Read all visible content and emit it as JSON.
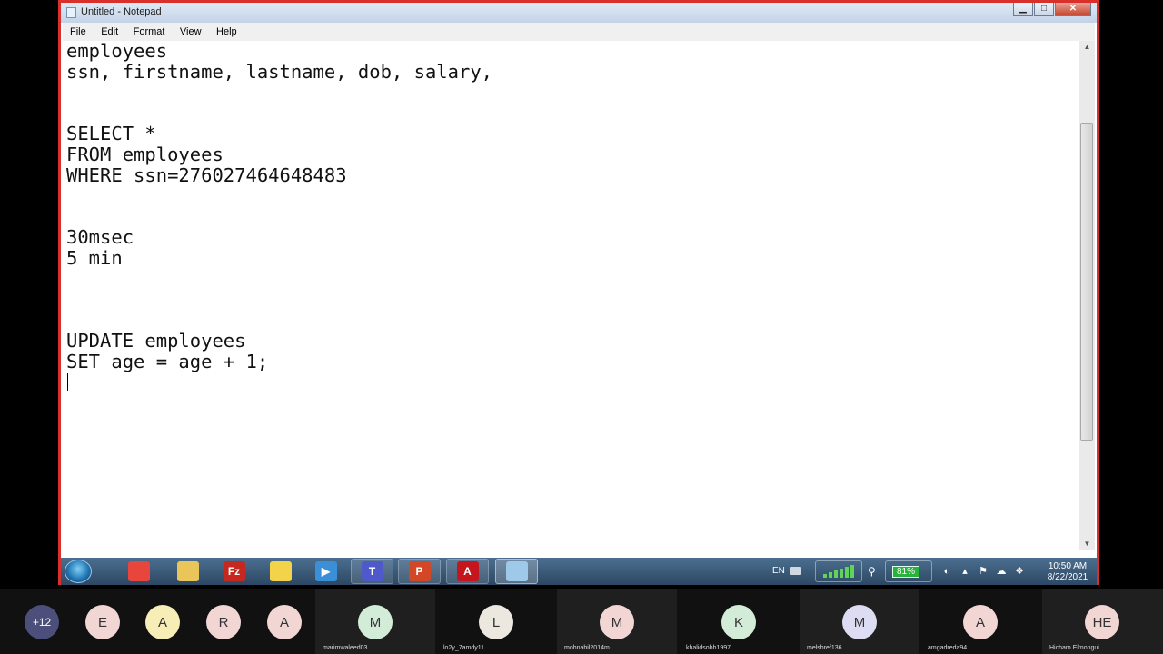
{
  "window": {
    "title": "Untitled - Notepad",
    "menu": [
      "File",
      "Edit",
      "Format",
      "View",
      "Help"
    ],
    "buttons": {
      "minimize": "▁",
      "maximize": "□",
      "close": "✕"
    }
  },
  "editor": {
    "lines": [
      "employees",
      "ssn, firstname, lastname, dob, salary,",
      "",
      "",
      "SELECT *",
      "FROM employees",
      "WHERE ssn=276027464648483",
      "",
      "",
      "30msec",
      "5 min",
      "",
      "",
      "",
      "UPDATE employees",
      "SET age = age + 1;"
    ]
  },
  "taskbar": {
    "apps": [
      {
        "name": "chrome-icon",
        "label": "",
        "color": "#e8453c"
      },
      {
        "name": "file-explorer-icon",
        "label": "",
        "color": "#e9c55a"
      },
      {
        "name": "filezilla-icon",
        "label": "Fz",
        "color": "#c6281f"
      },
      {
        "name": "folder-icon",
        "label": "",
        "color": "#f3d34a"
      },
      {
        "name": "media-player-icon",
        "label": "▶",
        "color": "#3a8fd6"
      },
      {
        "name": "teams-icon",
        "label": "T",
        "color": "#5059c9"
      },
      {
        "name": "powerpoint-icon",
        "label": "P",
        "color": "#d24726"
      },
      {
        "name": "acrobat-icon",
        "label": "A",
        "color": "#c4161c"
      },
      {
        "name": "notepad-icon",
        "label": "",
        "color": "#9ec9e8"
      }
    ],
    "tray": {
      "language": "EN",
      "battery": "81%",
      "time": "10:50 AM",
      "date": "8/22/2021"
    }
  },
  "participants": {
    "more_count": "+12",
    "small": [
      {
        "initial": "E",
        "color": "#f1d6d3"
      },
      {
        "initial": "A",
        "color": "#f7edb6"
      },
      {
        "initial": "R",
        "color": "#f1d6d3"
      },
      {
        "initial": "A",
        "color": "#f1d6d3"
      }
    ],
    "tiles": [
      {
        "initial": "M",
        "name": "marimwaleed03",
        "color": "#d3ecd8"
      },
      {
        "initial": "L",
        "name": "lo2y_7amdy11",
        "color": "#ece7df"
      },
      {
        "initial": "M",
        "name": "mohnabil2014m",
        "color": "#f1d6d3"
      },
      {
        "initial": "K",
        "name": "khalidsobh1997",
        "color": "#d3ecd8"
      },
      {
        "initial": "M",
        "name": "melshref136",
        "color": "#dcdcf3"
      },
      {
        "initial": "A",
        "name": "amgadreda94",
        "color": "#f1d6d3"
      },
      {
        "initial": "HE",
        "name": "Hicham Elmongui",
        "color": "#f1d6d3"
      }
    ]
  }
}
